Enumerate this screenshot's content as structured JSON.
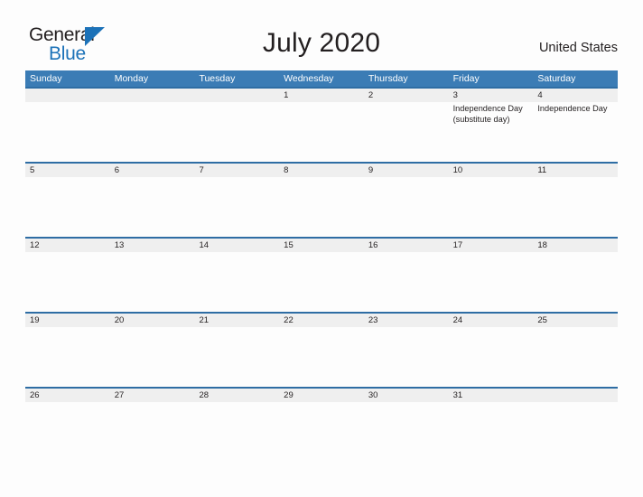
{
  "brand": {
    "name_part1": "General",
    "name_part2": "Blue",
    "flag_icon": "blue-triangle-flag-icon",
    "primary_color": "#1c72b8"
  },
  "header": {
    "title": "July 2020",
    "region": "United States"
  },
  "colors": {
    "header_blue": "#3b7cb5",
    "row_divider_blue": "#2e6da4",
    "date_band_gray": "#efefef",
    "page_background": "#fdfdfd",
    "text": "#231f20"
  },
  "calendar": {
    "month": "July",
    "year": "2020",
    "weekdays": [
      "Sunday",
      "Monday",
      "Tuesday",
      "Wednesday",
      "Thursday",
      "Friday",
      "Saturday"
    ],
    "weeks": [
      {
        "days": [
          {
            "date": "",
            "events": []
          },
          {
            "date": "",
            "events": []
          },
          {
            "date": "",
            "events": []
          },
          {
            "date": "1",
            "events": []
          },
          {
            "date": "2",
            "events": []
          },
          {
            "date": "3",
            "events": [
              "Independence Day (substitute day)"
            ]
          },
          {
            "date": "4",
            "events": [
              "Independence Day"
            ]
          }
        ]
      },
      {
        "days": [
          {
            "date": "5",
            "events": []
          },
          {
            "date": "6",
            "events": []
          },
          {
            "date": "7",
            "events": []
          },
          {
            "date": "8",
            "events": []
          },
          {
            "date": "9",
            "events": []
          },
          {
            "date": "10",
            "events": []
          },
          {
            "date": "11",
            "events": []
          }
        ]
      },
      {
        "days": [
          {
            "date": "12",
            "events": []
          },
          {
            "date": "13",
            "events": []
          },
          {
            "date": "14",
            "events": []
          },
          {
            "date": "15",
            "events": []
          },
          {
            "date": "16",
            "events": []
          },
          {
            "date": "17",
            "events": []
          },
          {
            "date": "18",
            "events": []
          }
        ]
      },
      {
        "days": [
          {
            "date": "19",
            "events": []
          },
          {
            "date": "20",
            "events": []
          },
          {
            "date": "21",
            "events": []
          },
          {
            "date": "22",
            "events": []
          },
          {
            "date": "23",
            "events": []
          },
          {
            "date": "24",
            "events": []
          },
          {
            "date": "25",
            "events": []
          }
        ]
      },
      {
        "days": [
          {
            "date": "26",
            "events": []
          },
          {
            "date": "27",
            "events": []
          },
          {
            "date": "28",
            "events": []
          },
          {
            "date": "29",
            "events": []
          },
          {
            "date": "30",
            "events": []
          },
          {
            "date": "31",
            "events": []
          },
          {
            "date": "",
            "events": []
          }
        ]
      }
    ]
  }
}
